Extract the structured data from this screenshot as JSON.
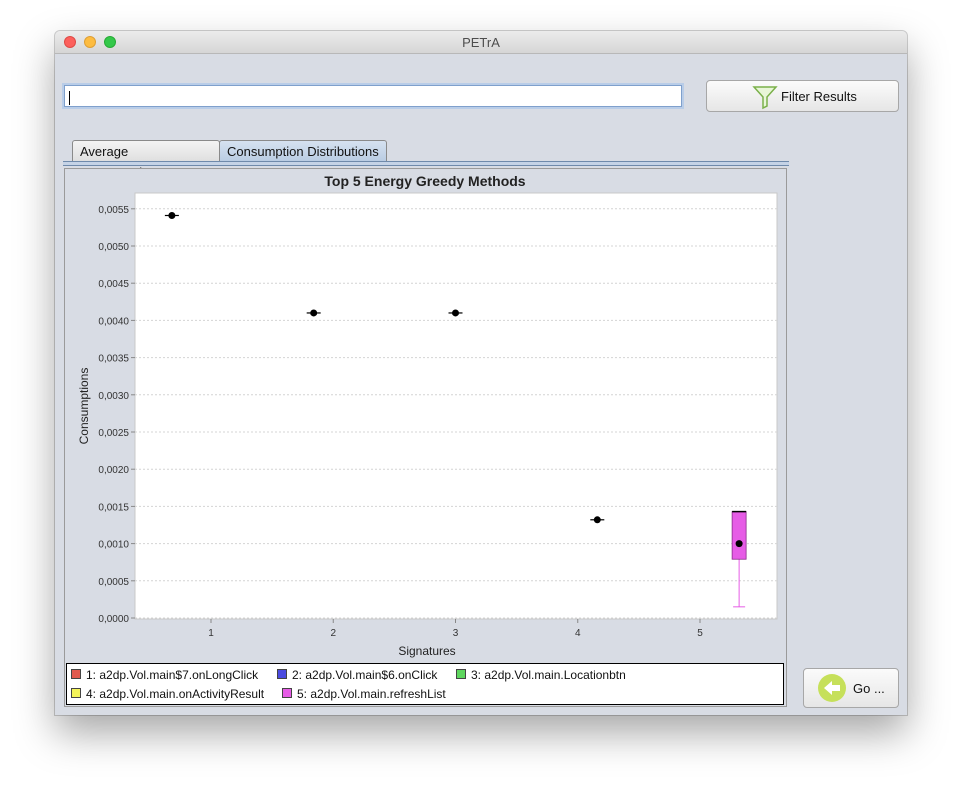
{
  "window": {
    "title": "PETrA"
  },
  "search": {
    "value": ""
  },
  "filter_button": {
    "label": "Filter Results",
    "icon": "funnel-icon"
  },
  "tabs": [
    {
      "label": "Average Consumptions",
      "selected": false
    },
    {
      "label": "Consumption Distributions",
      "selected": true
    }
  ],
  "go_button": {
    "label": "Go ...",
    "icon": "arrow-left-icon"
  },
  "legend": [
    {
      "label": "1: a2dp.Vol.main$7.onLongClick",
      "color": "#e05a4e"
    },
    {
      "label": "2: a2dp.Vol.main$6.onClick",
      "color": "#4b4be0"
    },
    {
      "label": "3: a2dp.Vol.main.Locationbtn",
      "color": "#5ed65e"
    },
    {
      "label": "4: a2dp.Vol.main.onActivityResult",
      "color": "#f4f45a"
    },
    {
      "label": "5: a2dp.Vol.main.refreshList",
      "color": "#e65ce6"
    }
  ],
  "chart_data": {
    "type": "box",
    "title": "Top 5 Energy Greedy Methods",
    "xlabel": "Signatures",
    "ylabel": "Consumptions",
    "categories": [
      "1",
      "2",
      "3",
      "4",
      "5"
    ],
    "ylim": [
      0,
      0.0057
    ],
    "yticks": [
      "0,0000",
      "0,0005",
      "0,0010",
      "0,0015",
      "0,0020",
      "0,0025",
      "0,0030",
      "0,0035",
      "0,0040",
      "0,0045",
      "0,0050",
      "0,0055"
    ],
    "ytick_values": [
      0,
      0.0005,
      0.001,
      0.0015,
      0.002,
      0.0025,
      0.003,
      0.0035,
      0.004,
      0.0045,
      0.005,
      0.0055
    ],
    "grid": true,
    "series": [
      {
        "name": "1: a2dp.Vol.main$7.onLongClick",
        "category": "1",
        "mean": 0.00541,
        "median": 0.00541,
        "q1": 0.00541,
        "q3": 0.00541,
        "min": 0.00541,
        "max": 0.00541,
        "color": "#e05a4e"
      },
      {
        "name": "2: a2dp.Vol.main$6.onClick",
        "category": "2",
        "mean": 0.0041,
        "median": 0.0041,
        "q1": 0.0041,
        "q3": 0.0041,
        "min": 0.0041,
        "max": 0.0041,
        "color": "#4b4be0"
      },
      {
        "name": "3: a2dp.Vol.main.Locationbtn",
        "category": "3",
        "mean": 0.0041,
        "median": 0.0041,
        "q1": 0.0041,
        "q3": 0.0041,
        "min": 0.0041,
        "max": 0.0041,
        "color": "#5ed65e"
      },
      {
        "name": "4: a2dp.Vol.main.onActivityResult",
        "category": "4",
        "mean": 0.00132,
        "median": 0.00132,
        "q1": 0.00132,
        "q3": 0.00132,
        "min": 0.00132,
        "max": 0.00132,
        "color": "#f4f45a"
      },
      {
        "name": "5: a2dp.Vol.main.refreshList",
        "category": "5",
        "mean": 0.001,
        "median": 0.00143,
        "q1": 0.00079,
        "q3": 0.00143,
        "min": 0.00015,
        "max": 0.00143,
        "color": "#e65ce6"
      }
    ]
  }
}
